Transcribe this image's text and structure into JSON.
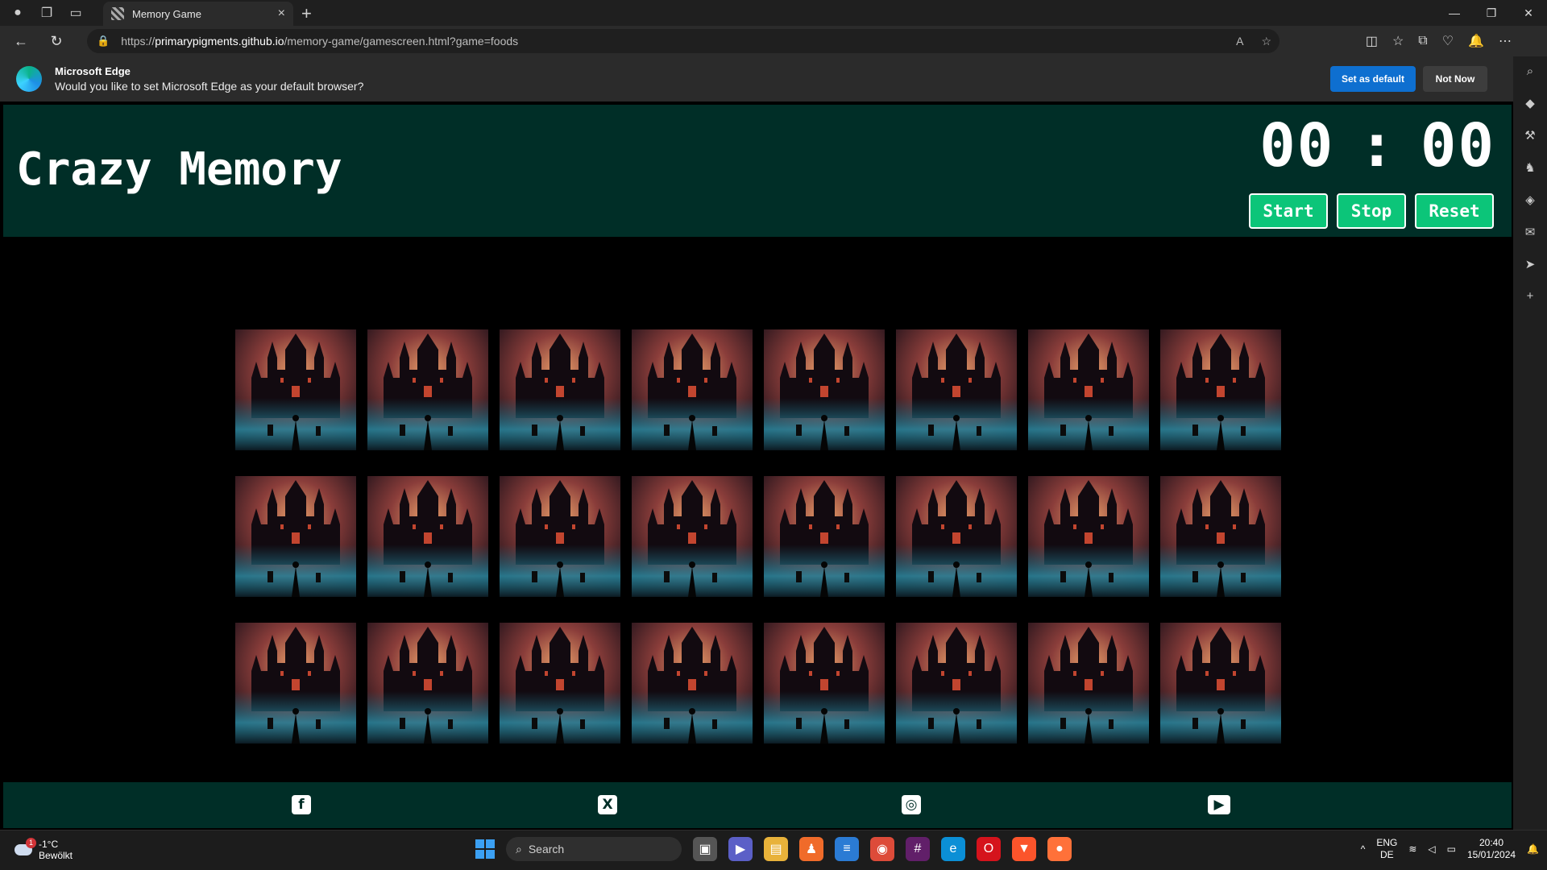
{
  "browser": {
    "tab_title": "Memory Game",
    "url_prefix": "https://",
    "url_host": "primarypigments.github.io",
    "url_path": "/memory-game/gamescreen.html?game=foods"
  },
  "infobar": {
    "app": "Microsoft Edge",
    "message": "Would you like to set Microsoft Edge as your default browser?",
    "set_default": "Set as default",
    "not_now": "Not Now"
  },
  "game": {
    "title": "Crazy Memory",
    "timer_minutes": "00",
    "timer_sep": ":",
    "timer_seconds": "00",
    "start_label": "Start",
    "stop_label": "Stop",
    "reset_label": "Reset",
    "card_rows": 3,
    "card_columns": 8,
    "card_back_icon": "haunted-castle-card-back",
    "colors": {
      "header_bg": "#002e27",
      "button_bg": "#0cc579"
    }
  },
  "footer": {
    "links": [
      {
        "icon": "facebook-icon",
        "glyph": "f"
      },
      {
        "icon": "x-icon",
        "glyph": "X"
      },
      {
        "icon": "instagram-icon",
        "glyph": "◎"
      },
      {
        "icon": "youtube-icon",
        "glyph": "▶"
      }
    ]
  },
  "taskbar": {
    "weather_temp": "-1°C",
    "weather_desc": "Bewölkt",
    "weather_badge": "1",
    "search_placeholder": "Search",
    "lang1": "ENG",
    "lang2": "DE",
    "time": "20:40",
    "date": "15/01/2024"
  }
}
